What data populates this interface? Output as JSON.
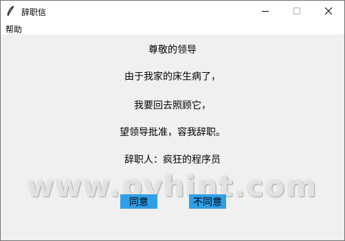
{
  "window": {
    "title": "辞职信",
    "icon": "feather-icon",
    "controls": [
      "minimize-icon",
      "maximize-icon",
      "close-icon"
    ]
  },
  "menubar": {
    "items": [
      {
        "label": "帮助"
      }
    ]
  },
  "letter": {
    "lines": [
      "尊敬的领导",
      "由于我家的床生病了，",
      "我要回去照顾它，",
      "望领导批准，容我辞职。",
      "辞职人：疯狂的程序员"
    ]
  },
  "watermark": "www.pyhint.com",
  "buttons": {
    "agree_label": "同意",
    "disagree_label": "不同意",
    "color": "#2f9fe8"
  }
}
